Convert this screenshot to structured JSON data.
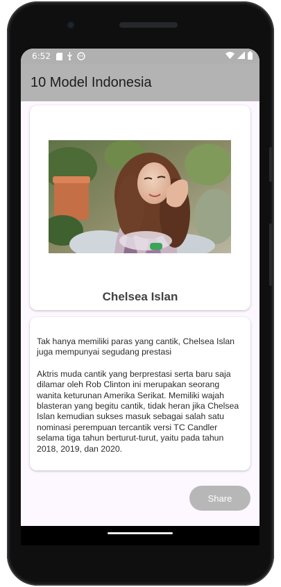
{
  "status_bar": {
    "time": "6:52",
    "left_icons": [
      "sd-card-icon",
      "usb-icon",
      "android-icon"
    ],
    "right_icons": [
      "wifi-icon",
      "signal-icon",
      "battery-icon"
    ]
  },
  "app_bar": {
    "title": "10 Model Indonesia"
  },
  "profile": {
    "photo": "portrait-photo",
    "name": "Chelsea Islan"
  },
  "description": {
    "paragraph_1": "Tak hanya memiliki paras yang cantik, Chelsea Islan juga mempunyai segudang prestasi",
    "paragraph_2": "Aktris muda cantik yang berprestasi serta baru saja dilamar oleh Rob Clinton ini merupakan seorang wanita keturunan Amerika Serikat. Memiliki wajah blasteran yang begitu cantik, tidak heran jika Chelsea Islan kemudian sukses masuk sebagai salah satu nominasi perempuan tercantik versi TC Candler selama tiga tahun berturut-turut, yaitu pada tahun 2018, 2019, dan 2020."
  },
  "actions": {
    "share_label": "Share"
  },
  "colors": {
    "app_bar": "#b3b3b3",
    "background": "#fdf7ff",
    "card": "#ffffff",
    "button": "#b7b7b7"
  }
}
